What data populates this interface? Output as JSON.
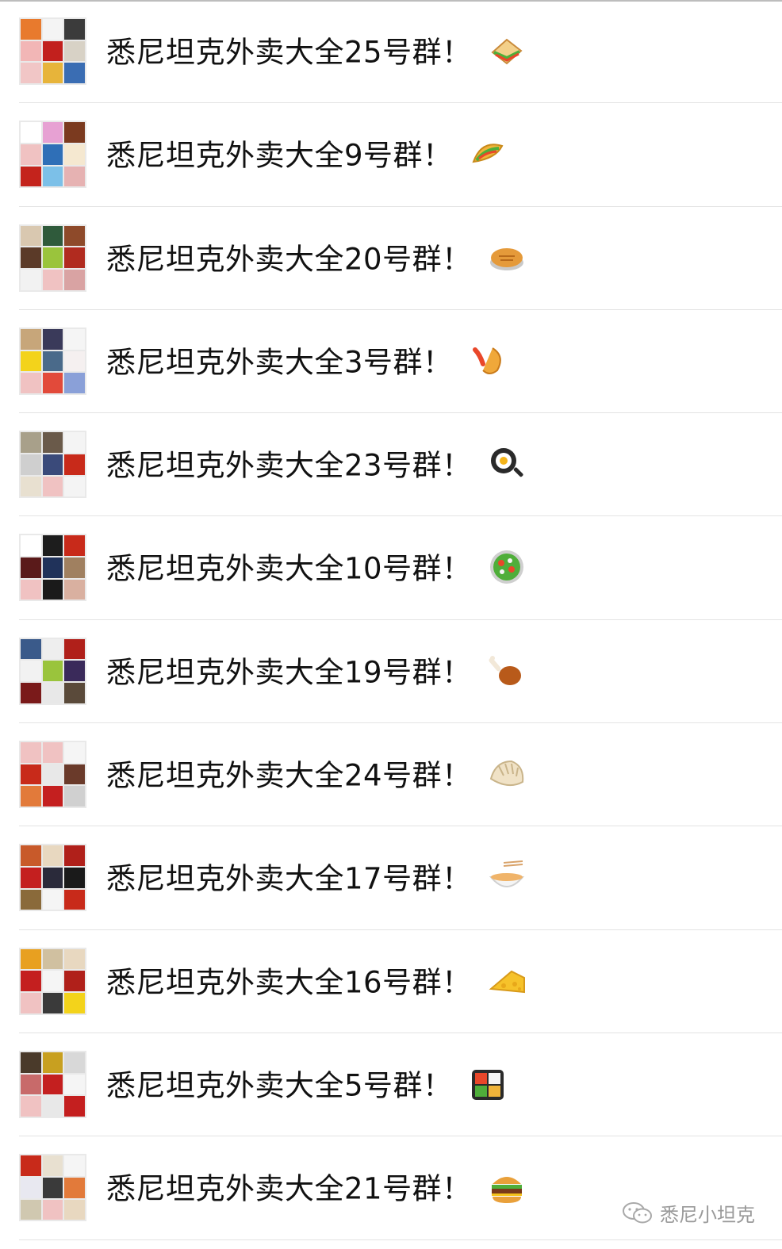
{
  "groups": [
    {
      "name": "悉尼坦克外卖大全25号群！",
      "icon": "sandwich-icon",
      "avatar_colors": [
        "#e87a2d",
        "#f4f4f4",
        "#3b3b3b",
        "#f2b6b6",
        "#c2201d",
        "#d8d2c6",
        "#f1c6c6",
        "#e7b43a",
        "#3a6db3"
      ]
    },
    {
      "name": "悉尼坦克外卖大全9号群！",
      "icon": "taco-icon",
      "avatar_colors": [
        "#ffffff",
        "#e7a1d3",
        "#7b3a1f",
        "#f0c2c2",
        "#2f6fb7",
        "#f5e8d0",
        "#c4231c",
        "#7cc0e8",
        "#e6b2b2"
      ]
    },
    {
      "name": "悉尼坦克外卖大全20号群！",
      "icon": "pie-icon",
      "avatar_colors": [
        "#d9c8b0",
        "#2f5a3b",
        "#8e4a2a",
        "#5b3a28",
        "#9ac43c",
        "#b12b1f",
        "#f2f2f2",
        "#f0c2c2",
        "#d9a3a3"
      ]
    },
    {
      "name": "悉尼坦克外卖大全3号群！",
      "icon": "shrimp-icon",
      "avatar_colors": [
        "#c7a67a",
        "#3a3a5a",
        "#f5f5f5",
        "#f3d31b",
        "#4a6a8a",
        "#f5f0f0",
        "#f0c2c2",
        "#e24a3a",
        "#8aa0d8"
      ]
    },
    {
      "name": "悉尼坦克外卖大全23号群！",
      "icon": "frying-pan-icon",
      "avatar_colors": [
        "#a8a08a",
        "#6a5a4a",
        "#f4f4f4",
        "#cfcfcf",
        "#3a4a7a",
        "#c82a1a",
        "#e8e0d0",
        "#f0c2c2",
        "#f4f4f4"
      ]
    },
    {
      "name": "悉尼坦克外卖大全10号群！",
      "icon": "salad-icon",
      "avatar_colors": [
        "#ffffff",
        "#1d1d1d",
        "#c82a1a",
        "#5a1a1a",
        "#20325a",
        "#a08060",
        "#f0c2c2",
        "#1a1a1a",
        "#d9b0a0"
      ]
    },
    {
      "name": "悉尼坦克外卖大全19号群！",
      "icon": "poultry-leg-icon",
      "avatar_colors": [
        "#3a5a8a",
        "#eeeeee",
        "#b0201a",
        "#f2f2f2",
        "#9ac43c",
        "#3a2a5a",
        "#7a1a1a",
        "#e8e8e8",
        "#5a4a3a"
      ]
    },
    {
      "name": "悉尼坦克外卖大全24号群！",
      "icon": "dumpling-icon",
      "avatar_colors": [
        "#f0c2c2",
        "#f0c2c2",
        "#f5f5f5",
        "#c82a1a",
        "#e8e8e8",
        "#6a3a2a",
        "#e27a3a",
        "#c41f1f",
        "#d0d0d0"
      ]
    },
    {
      "name": "悉尼坦克外卖大全17号群！",
      "icon": "ramen-icon",
      "avatar_colors": [
        "#c85a2a",
        "#e8d8c0",
        "#b0201a",
        "#c41f1f",
        "#2a2a3a",
        "#1a1a1a",
        "#8a6a3a",
        "#f5f5f5",
        "#c82a1a"
      ]
    },
    {
      "name": "悉尼坦克外卖大全16号群！",
      "icon": "cheese-icon",
      "avatar_colors": [
        "#e8a020",
        "#d0c0a0",
        "#e8d8c0",
        "#c41f1f",
        "#f5f5f5",
        "#b0201a",
        "#f0c2c2",
        "#3a3a3a",
        "#f3d31b"
      ]
    },
    {
      "name": "悉尼坦克外卖大全5号群！",
      "icon": "bento-box-icon",
      "avatar_colors": [
        "#4a3a2a",
        "#c8a020",
        "#d8d8d8",
        "#c86a6a",
        "#c41f1f",
        "#f5f5f5",
        "#f0c2c2",
        "#e8e8e8",
        "#c41f1f"
      ]
    },
    {
      "name": "悉尼坦克外卖大全21号群！",
      "icon": "hamburger-icon",
      "avatar_colors": [
        "#c82a1a",
        "#e8e0d0",
        "#f5f5f5",
        "#e8e8f0",
        "#3a3a3a",
        "#e27a3a",
        "#d0c8b0",
        "#f0c2c2",
        "#e8d8c0"
      ]
    }
  ],
  "watermark": {
    "text": "悉尼小坦克"
  }
}
